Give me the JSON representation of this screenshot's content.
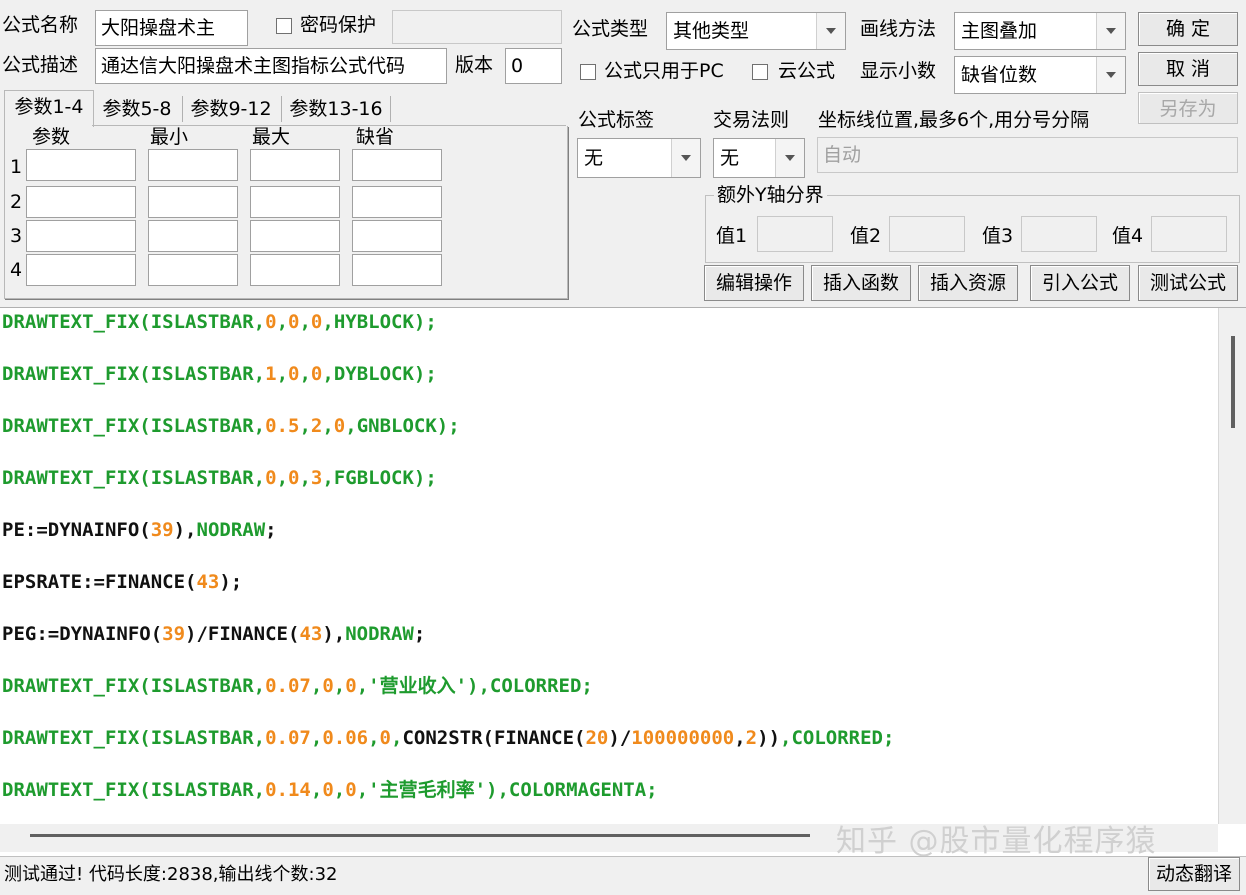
{
  "header": {
    "name_label": "公式名称",
    "name_value": "大阳操盘术主",
    "password_label": "密码保护",
    "password_value": "",
    "desc_label": "公式描述",
    "desc_value": "通达信大阳操盘术主图指标公式代码",
    "version_label": "版本",
    "version_value": "0",
    "type_label": "公式类型",
    "type_value": "其他类型",
    "draw_label": "画线方法",
    "draw_value": "主图叠加",
    "pc_only_label": "公式只用于PC",
    "cloud_label": "云公式",
    "decimals_label": "显示小数",
    "decimals_value": "缺省位数"
  },
  "buttons": {
    "ok": "确  定",
    "cancel": "取  消",
    "save_as": "另存为",
    "edit_ops": "编辑操作",
    "insert_func": "插入函数",
    "insert_res": "插入资源",
    "import_formula": "引入公式",
    "test_formula": "测试公式",
    "translate": "动态翻译"
  },
  "params": {
    "tabs": [
      "参数1-4",
      "参数5-8",
      "参数9-12",
      "参数13-16"
    ],
    "headers": [
      "参数",
      "最小",
      "最大",
      "缺省"
    ],
    "rows": [
      "1",
      "2",
      "3",
      "4"
    ]
  },
  "options": {
    "tag_label": "公式标签",
    "tag_value": "无",
    "rule_label": "交易法则",
    "rule_value": "无",
    "axis_label": "坐标线位置,最多6个,用分号分隔",
    "axis_value": "自动",
    "extra_y_title": "额外Y轴分界",
    "value_labels": [
      "值1",
      "值2",
      "值3",
      "值4"
    ]
  },
  "code": [
    [
      [
        "DRAWTEXT_FIX(ISLASTBAR,",
        "g"
      ],
      [
        "0",
        "o"
      ],
      [
        ",",
        "g"
      ],
      [
        "0",
        "o"
      ],
      [
        ",",
        "g"
      ],
      [
        "0",
        "o"
      ],
      [
        ",HYBLOCK);",
        "g"
      ]
    ],
    [
      [
        "DRAWTEXT_FIX(ISLASTBAR,",
        "g"
      ],
      [
        "1",
        "o"
      ],
      [
        ",",
        "g"
      ],
      [
        "0",
        "o"
      ],
      [
        ",",
        "g"
      ],
      [
        "0",
        "o"
      ],
      [
        ",DYBLOCK);",
        "g"
      ]
    ],
    [
      [
        "DRAWTEXT_FIX(ISLASTBAR,",
        "g"
      ],
      [
        "0.5",
        "o"
      ],
      [
        ",",
        "g"
      ],
      [
        "2",
        "o"
      ],
      [
        ",",
        "g"
      ],
      [
        "0",
        "o"
      ],
      [
        ",GNBLOCK);",
        "g"
      ]
    ],
    [
      [
        "DRAWTEXT_FIX(ISLASTBAR,",
        "g"
      ],
      [
        "0",
        "o"
      ],
      [
        ",",
        "g"
      ],
      [
        "0",
        "o"
      ],
      [
        ",",
        "g"
      ],
      [
        "3",
        "o"
      ],
      [
        ",FGBLOCK);",
        "g"
      ]
    ],
    [
      [
        "PE:=DYNAINFO(",
        "k"
      ],
      [
        "39",
        "o"
      ],
      [
        "),",
        "k"
      ],
      [
        "NODRAW",
        "g"
      ],
      [
        ";",
        "k"
      ]
    ],
    [
      [
        "EPSRATE:=FINANCE(",
        "k"
      ],
      [
        "43",
        "o"
      ],
      [
        ");",
        "k"
      ]
    ],
    [
      [
        "PEG:=DYNAINFO(",
        "k"
      ],
      [
        "39",
        "o"
      ],
      [
        ")/FINANCE(",
        "k"
      ],
      [
        "43",
        "o"
      ],
      [
        "),",
        "k"
      ],
      [
        "NODRAW",
        "g"
      ],
      [
        ";",
        "k"
      ]
    ],
    [
      [
        "DRAWTEXT_FIX(ISLASTBAR,",
        "g"
      ],
      [
        "0.07",
        "o"
      ],
      [
        ",",
        "g"
      ],
      [
        "0",
        "o"
      ],
      [
        ",",
        "g"
      ],
      [
        "0",
        "o"
      ],
      [
        ",'营业收入'),COLORRED;",
        "g"
      ]
    ],
    [
      [
        "DRAWTEXT_FIX(ISLASTBAR,",
        "g"
      ],
      [
        "0.07",
        "o"
      ],
      [
        ",",
        "g"
      ],
      [
        "0.06",
        "o"
      ],
      [
        ",",
        "g"
      ],
      [
        "0",
        "o"
      ],
      [
        ",",
        "g"
      ],
      [
        "CON2STR(FINANCE(",
        "k"
      ],
      [
        "20",
        "o"
      ],
      [
        ")/",
        "k"
      ],
      [
        "100000000",
        "o"
      ],
      [
        ",",
        "k"
      ],
      [
        "2",
        "o"
      ],
      [
        "))",
        "k"
      ],
      [
        ",COLORRED;",
        "g"
      ]
    ],
    [
      [
        "DRAWTEXT_FIX(ISLASTBAR,",
        "g"
      ],
      [
        "0.14",
        "o"
      ],
      [
        ",",
        "g"
      ],
      [
        "0",
        "o"
      ],
      [
        ",",
        "g"
      ],
      [
        "0",
        "o"
      ],
      [
        ",'主营毛利率'),COLORMAGENTA;",
        "g"
      ]
    ]
  ],
  "code_colors": {
    "g": "#1e9b2e",
    "o": "#f08a1c",
    "k": "#111111"
  },
  "status": "测试通过! 代码长度:2838,输出线个数:32",
  "watermark": "知乎 @股市量化程序猿"
}
